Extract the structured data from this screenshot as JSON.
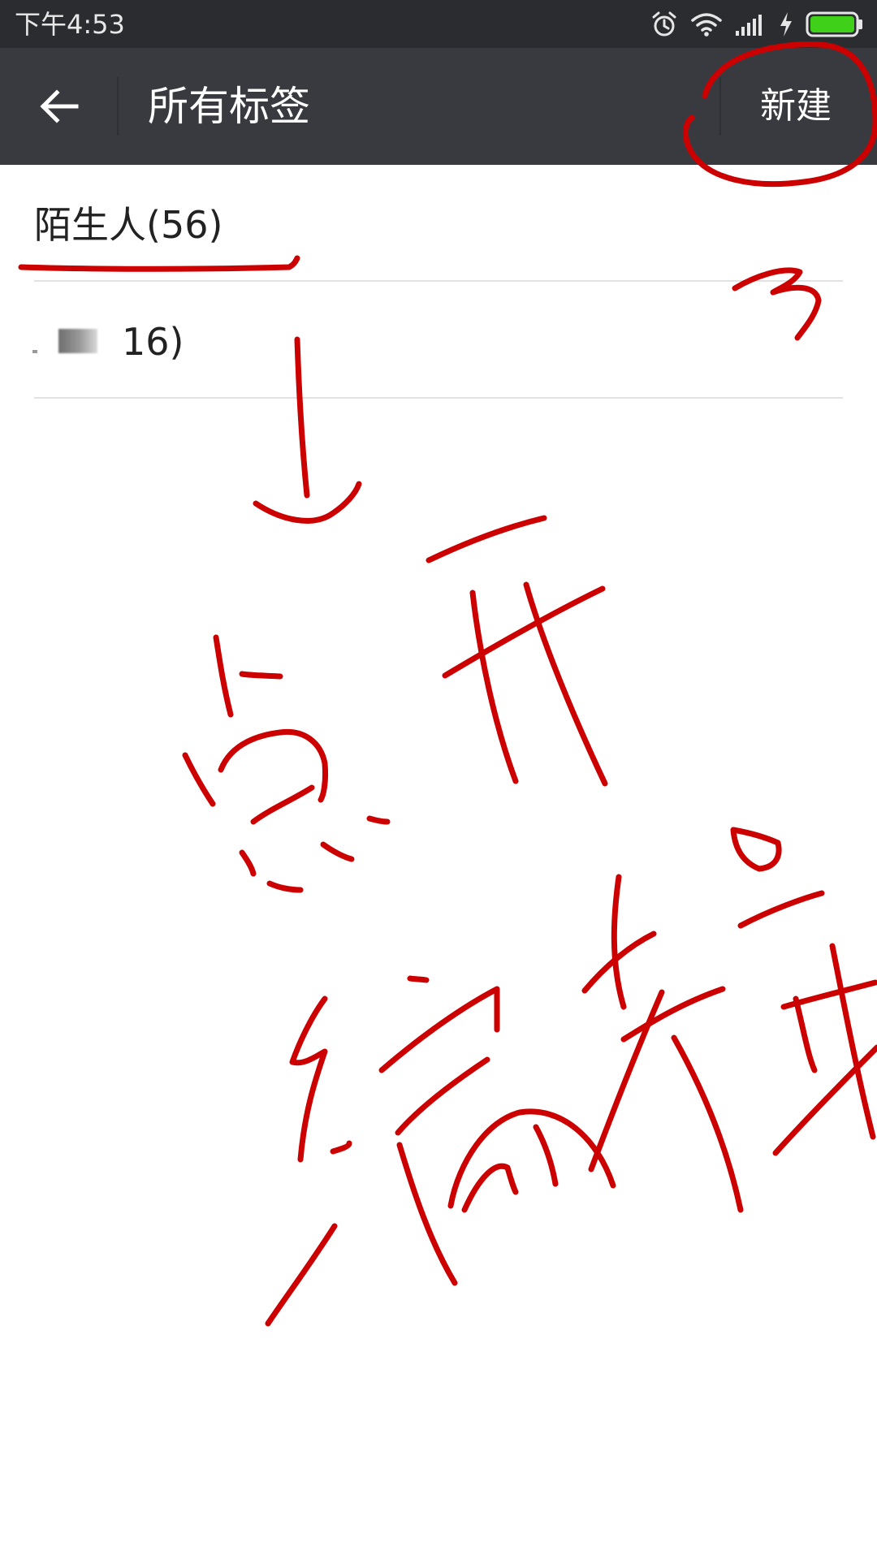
{
  "status_bar": {
    "time": "下午4:53",
    "icons": [
      "alarm-icon",
      "wifi-icon",
      "signal-icon",
      "charging-icon",
      "battery-icon"
    ],
    "battery_color": "#3fd11a"
  },
  "app_bar": {
    "title": "所有标签",
    "new_label": "新建",
    "background": "#393a3f"
  },
  "tags": [
    {
      "label": "陌生人(56)"
    },
    {
      "label": "16)"
    }
  ],
  "annotation": {
    "color": "#cc0000",
    "marker": "3",
    "handwritten_text": "点开编辑"
  }
}
